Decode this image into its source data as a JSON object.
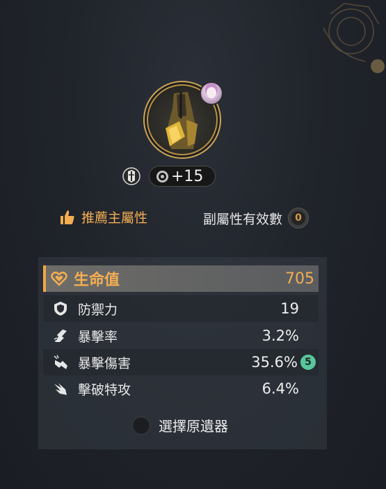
{
  "relic": {
    "level": "+15"
  },
  "labels": {
    "recommend": "推薦主屬性",
    "effective_substats": "副屬性有效數",
    "effective_count": "0"
  },
  "main_stat": {
    "name": "生命值",
    "value": "705",
    "icon": "heart-icon"
  },
  "sub_stats": [
    {
      "name": "防禦力",
      "value": "19",
      "icon": "shield-icon"
    },
    {
      "name": "暴擊率",
      "value": "3.2%",
      "icon": "crit-rate-icon"
    },
    {
      "name": "暴擊傷害",
      "value": "35.6%",
      "icon": "crit-dmg-icon",
      "rolls": "5"
    },
    {
      "name": "擊破特攻",
      "value": "6.4%",
      "icon": "break-effect-icon"
    }
  ],
  "select_button": {
    "label": "選擇原遺器"
  },
  "colors": {
    "accent": "#f4ae52",
    "roll_badge": "#58c59c"
  }
}
